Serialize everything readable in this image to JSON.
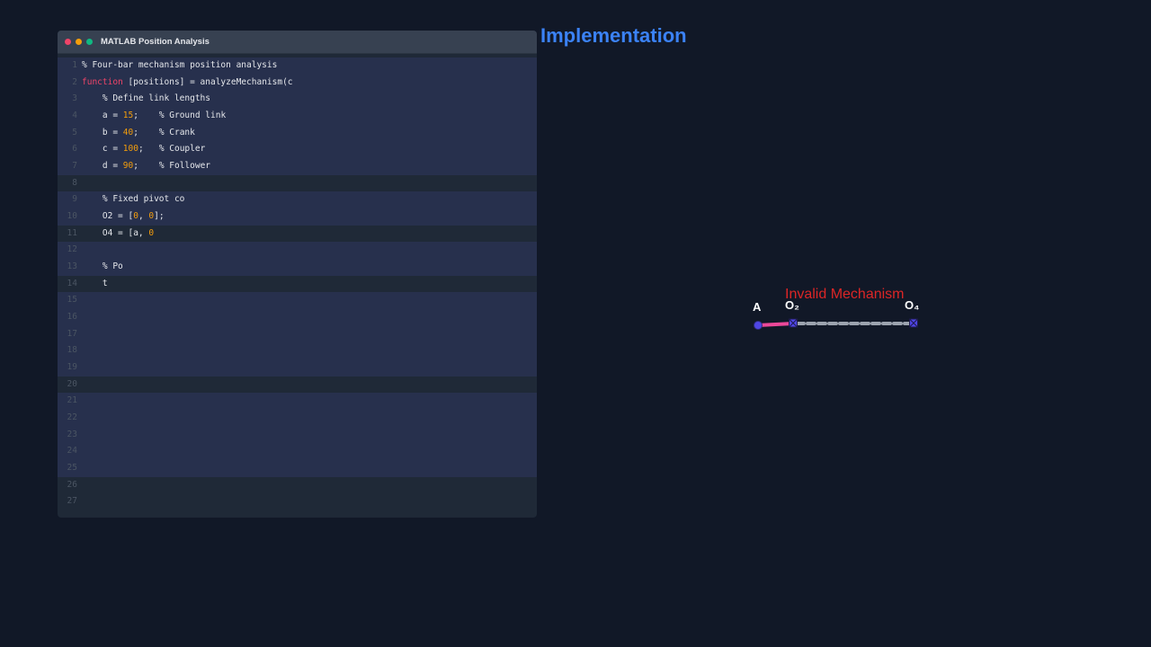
{
  "window": {
    "title": "MATLAB Position Analysis",
    "controls": [
      "close",
      "minimize",
      "maximize"
    ]
  },
  "code": {
    "lines": [
      {
        "n": "1",
        "text": "% Four-bar mechanism position analysis",
        "hl": true
      },
      {
        "n": "2",
        "text": "function [positions] = analyzeMechanism(c",
        "hl": true
      },
      {
        "n": "3",
        "text": "    % Define link lengths",
        "hl": true
      },
      {
        "n": "4",
        "text": "    a = 15;    % Ground link",
        "hl": true
      },
      {
        "n": "5",
        "text": "    b = 40;    % Crank",
        "hl": true
      },
      {
        "n": "6",
        "text": "    c = 100;   % Coupler",
        "hl": true
      },
      {
        "n": "7",
        "text": "    d = 90;    % Follower",
        "hl": true
      },
      {
        "n": "8",
        "text": "",
        "hl": false
      },
      {
        "n": "9",
        "text": "    % Fixed pivot co",
        "hl": true
      },
      {
        "n": "10",
        "text": "    O2 = [0, 0];",
        "hl": true
      },
      {
        "n": "11",
        "text": "    O4 = [a, 0",
        "hl": false
      },
      {
        "n": "12",
        "text": "",
        "hl": true
      },
      {
        "n": "13",
        "text": "    % Po",
        "hl": true
      },
      {
        "n": "14",
        "text": "    t",
        "hl": false
      },
      {
        "n": "15",
        "text": "",
        "hl": true
      },
      {
        "n": "16",
        "text": "",
        "hl": true
      },
      {
        "n": "17",
        "text": "",
        "hl": true
      },
      {
        "n": "18",
        "text": "",
        "hl": true
      },
      {
        "n": "19",
        "text": "",
        "hl": true
      },
      {
        "n": "20",
        "text": "",
        "hl": false
      },
      {
        "n": "21",
        "text": "",
        "hl": true
      },
      {
        "n": "22",
        "text": "",
        "hl": true
      },
      {
        "n": "23",
        "text": "",
        "hl": true
      },
      {
        "n": "24",
        "text": "",
        "hl": true
      },
      {
        "n": "25",
        "text": "",
        "hl": true
      },
      {
        "n": "26",
        "text": "",
        "hl": false
      },
      {
        "n": "27",
        "text": "",
        "hl": false
      }
    ]
  },
  "heading": "Implementation",
  "mechanism": {
    "status": "Invalid Mechanism",
    "labels": {
      "a": "A",
      "o2": "O₂",
      "o4": "O₄"
    },
    "colors": {
      "crank": "#ec4899",
      "ground": "#9ca3af",
      "joint": "#4f46e5",
      "status": "#dc2626"
    }
  }
}
